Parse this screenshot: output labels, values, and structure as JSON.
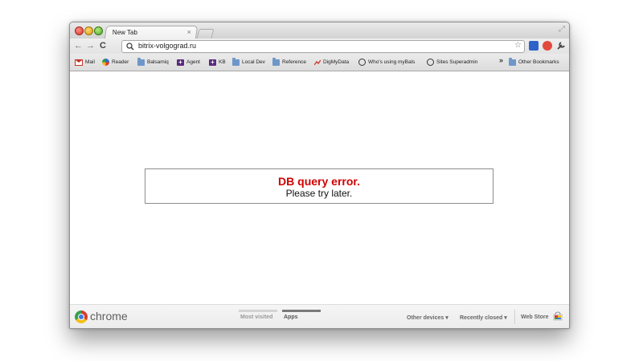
{
  "tab": {
    "title": "New Tab",
    "close": "×"
  },
  "toolbar": {
    "back": "←",
    "forward": "→",
    "reload": "C",
    "url": "bitrix-volgograd.ru",
    "star": "☆"
  },
  "bookmarks": {
    "items": [
      {
        "label": "Mail",
        "icon": "gmail-icon"
      },
      {
        "label": "Reader",
        "icon": "reader-icon"
      },
      {
        "label": "Balsamiq",
        "icon": "folder-icon"
      },
      {
        "label": "Agent",
        "icon": "plus-icon"
      },
      {
        "label": "KB",
        "icon": "plus-icon"
      },
      {
        "label": "Local Dev",
        "icon": "folder-icon"
      },
      {
        "label": "Reference",
        "icon": "folder-icon"
      },
      {
        "label": "DigMyData",
        "icon": "chart-icon"
      },
      {
        "label": "Who's using myBals",
        "icon": "smile-icon"
      },
      {
        "label": "Sites Superadmin",
        "icon": "smile-icon"
      }
    ],
    "overflow": "»",
    "other": "Other Bookmarks"
  },
  "error": {
    "title": "DB query error.",
    "message": "Please try later."
  },
  "footer": {
    "brand": "chrome",
    "tabs": [
      "Most visited",
      "Apps"
    ],
    "active_tab": "Apps",
    "other_devices": "Other devices ▾",
    "recently_closed": "Recently closed ▾",
    "web_store": "Web Store"
  },
  "colors": {
    "error_title": "#d10000",
    "active_pager": "#7a7a7a",
    "inactive_pager": "#d3d3d3"
  }
}
